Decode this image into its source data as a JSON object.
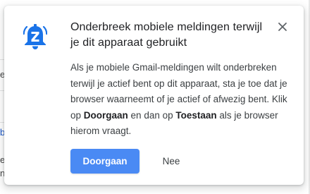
{
  "dialog": {
    "title": "Onderbreek mobiele meldingen terwijl je dit apparaat gebruikt",
    "body_part1": "Als je mobiele Gmail-meldingen wilt onderbreken terwijl je actief bent op dit apparaat, sta je toe dat je browser waarneemt of je actief of afwezig bent. Klik op ",
    "body_bold1": "Doorgaan",
    "body_part2": " en dan op ",
    "body_bold2": "Toestaan",
    "body_part3": " als je browser hierom vraagt.",
    "primary_button": "Doorgaan",
    "secondary_button": "Nee",
    "icon": "bell-z-icon",
    "close_icon": "close-icon"
  },
  "background": {
    "fragments": [
      "e",
      "b",
      "e",
      "n"
    ]
  },
  "colors": {
    "accent": "#4a8af4",
    "icon_blue": "#1a73e8",
    "title": "#202124",
    "body": "#3c4043"
  }
}
